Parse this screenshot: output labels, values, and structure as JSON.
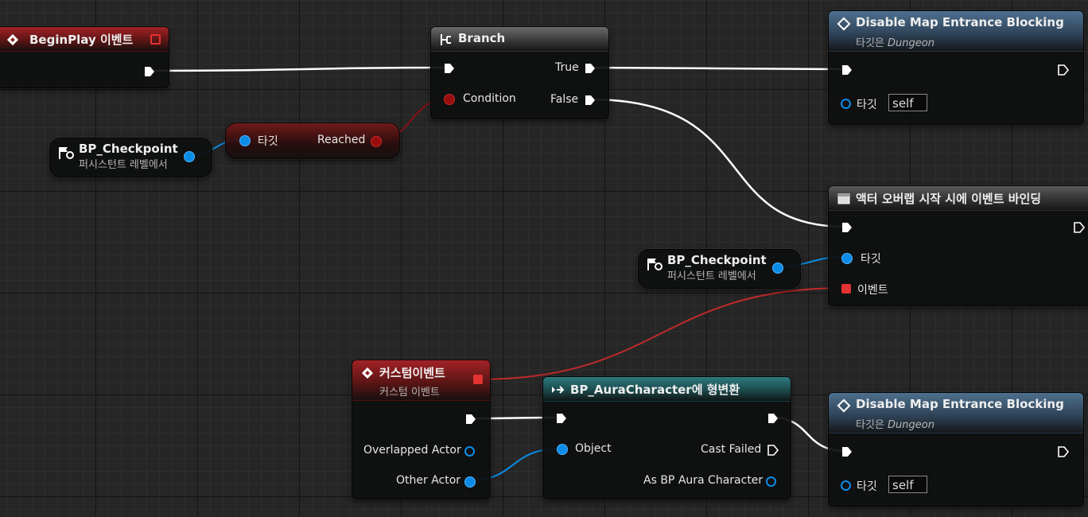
{
  "nodes": {
    "begin_play": {
      "title": "BeginPlay 이벤트"
    },
    "branch": {
      "title": "Branch",
      "pins": {
        "condition": "Condition",
        "true": "True",
        "false": "False"
      }
    },
    "disable_top": {
      "title": "Disable Map Entrance Blocking",
      "subtitle_prefix": "타깃은 ",
      "subtitle_value": "Dungeon",
      "target_label": "타깃",
      "target_value": "self"
    },
    "checkpoint_ref_1": {
      "title": "BP_Checkpoint",
      "subtitle": "퍼시스턴트 레벨에서"
    },
    "reached_getter": {
      "target_label": "타깃",
      "output_label": "Reached"
    },
    "bind_event": {
      "title": "액터 오버랩 시작 시에 이벤트 바인딩",
      "target_label": "타깃",
      "event_label": "이벤트"
    },
    "checkpoint_ref_2": {
      "title": "BP_Checkpoint",
      "subtitle": "퍼시스턴트 레벨에서"
    },
    "custom_event": {
      "title": "커스텀이벤트",
      "subtitle": "커스텀 이벤트",
      "pins": {
        "overlapped": "Overlapped Actor",
        "other": "Other Actor"
      }
    },
    "cast": {
      "title": "BP_AuraCharacter에 형변환",
      "pins": {
        "object": "Object",
        "cast_failed": "Cast Failed",
        "as_aura": "As BP Aura Character"
      }
    },
    "disable_bottom": {
      "title": "Disable Map Entrance Blocking",
      "subtitle_prefix": "타깃은 ",
      "subtitle_value": "Dungeon",
      "target_label": "타깃",
      "target_value": "self"
    }
  },
  "colors": {
    "exec_wire": "#ffffff",
    "object_wire": "#0b8ce6",
    "bool_wire": "#8a1010",
    "delegate_wire": "#c02a2a",
    "grid_bg": "#262626"
  },
  "icons": [
    "event-diamond-icon",
    "branch-icon",
    "function-icon",
    "actor-reference-icon",
    "cast-arrow-icon",
    "delegate-icon"
  ]
}
